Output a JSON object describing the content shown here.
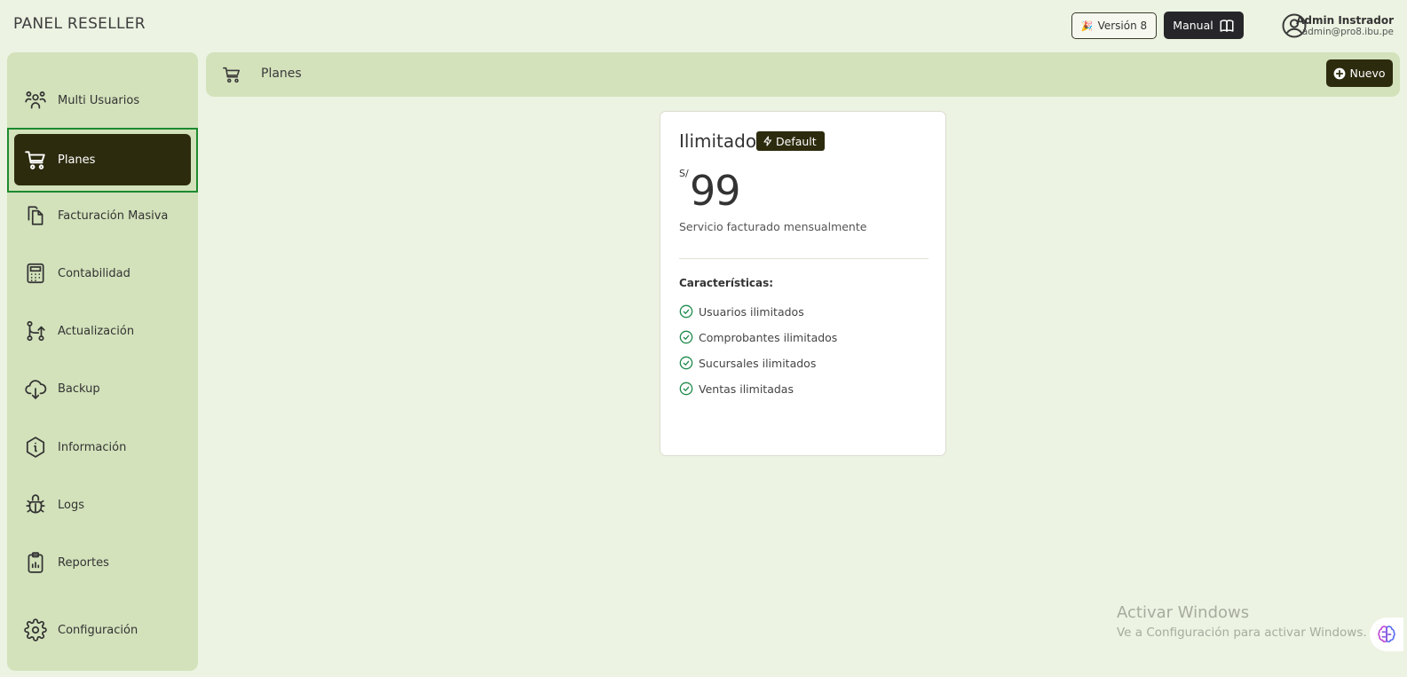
{
  "header": {
    "app_title": "PANEL RESELLER",
    "version_label": "Versión 8",
    "manual_label": "Manual",
    "user_name": "Admin Instrador",
    "user_email": "admin@pro8.ibu.pe"
  },
  "sidebar": {
    "items": [
      {
        "label": "Multi Usuarios",
        "icon": "users-icon"
      },
      {
        "label": "Planes",
        "icon": "cart-icon",
        "active": true
      },
      {
        "label": "Facturación Masiva",
        "icon": "files-icon"
      },
      {
        "label": "Contabilidad",
        "icon": "calculator-icon"
      },
      {
        "label": "Actualización",
        "icon": "git-branch-icon"
      },
      {
        "label": "Backup",
        "icon": "cloud-download-icon"
      },
      {
        "label": "Información",
        "icon": "info-hexagon-icon"
      },
      {
        "label": "Logs",
        "icon": "bug-icon"
      },
      {
        "label": "Reportes",
        "icon": "clipboard-icon"
      },
      {
        "label": "Configuración",
        "icon": "gear-icon"
      }
    ]
  },
  "topbar": {
    "title": "Planes",
    "new_button": "Nuevo"
  },
  "plan": {
    "name": "Ilimitado",
    "badge": "Default",
    "currency": "S/",
    "price": "99",
    "billing": "Servicio facturado mensualmente",
    "features_title": "Características:",
    "features": [
      "Usuarios ilimitados",
      "Comprobantes ilimitados",
      "Sucursales ilimitados",
      "Ventas ilimitadas"
    ]
  },
  "watermark": {
    "title": "Activar Windows",
    "subtitle": "Ve a Configuración para activar Windows."
  },
  "colors": {
    "background": "#ecf3e2",
    "panel": "#d3e2bb",
    "accent_dark": "#2d2b0e",
    "check_green": "#1f8a4c"
  }
}
